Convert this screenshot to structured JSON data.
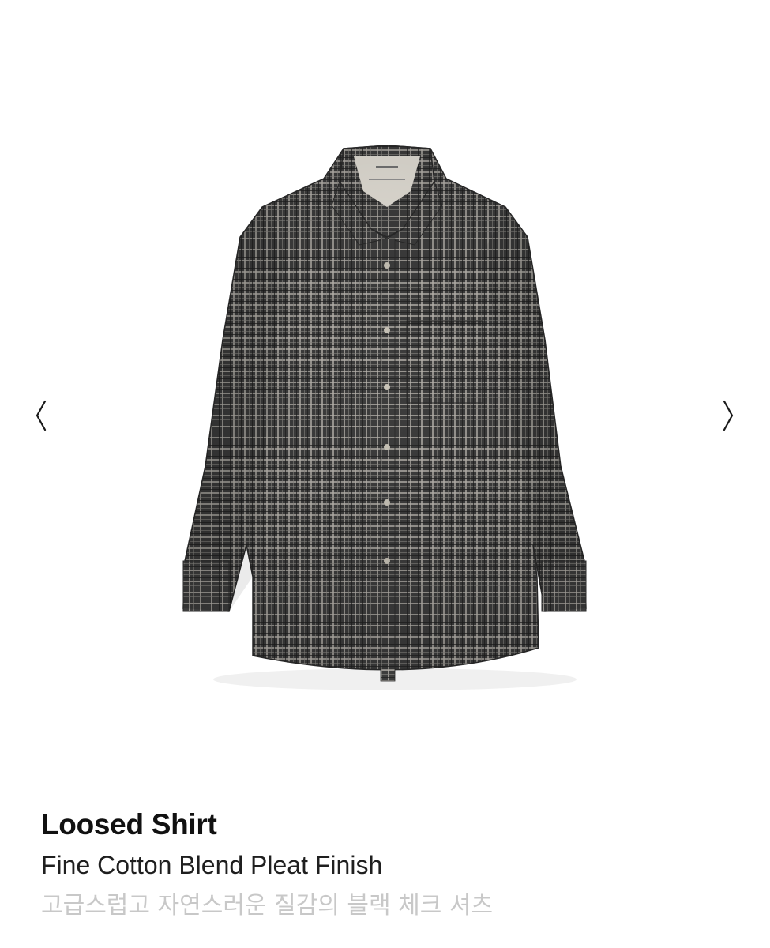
{
  "product": {
    "title": "Loosed Shirt",
    "subtitle": "Fine Cotton Blend Pleat Finish",
    "description": "고급스럽고 자연스러운 질감의 블랙 체크 셔츠"
  },
  "gallery": {
    "prev_icon": "chevron-left-icon",
    "next_icon": "chevron-right-icon",
    "image": "plaid-shirt"
  },
  "colors": {
    "background": "#ffffff",
    "shirt_base": "#3b3b3b",
    "check_light": "#c9c6c0",
    "description_text": "#c8c8c8"
  }
}
